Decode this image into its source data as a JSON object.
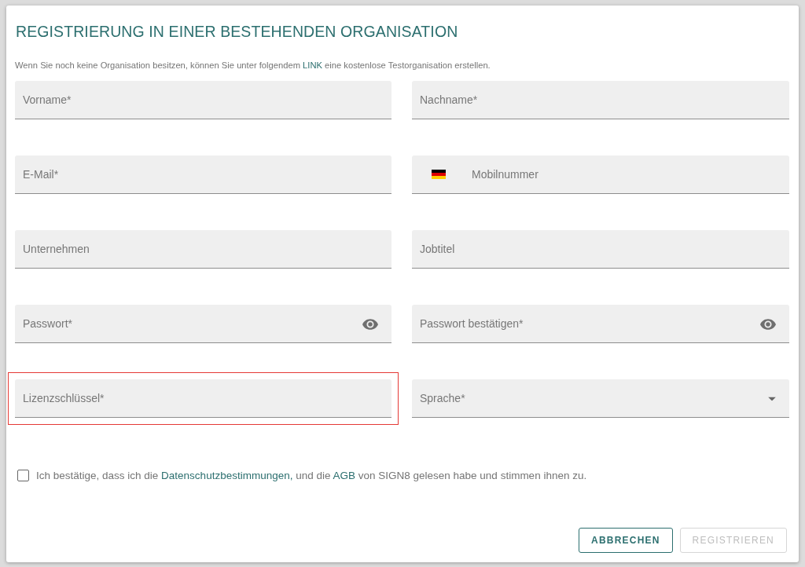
{
  "dialog": {
    "title": "REGISTRIERUNG IN EINER BESTEHENDEN ORGANISATION",
    "intro": [
      {
        "kind": "text",
        "text": "Wenn Sie noch keine Organisation besitzen, können Sie unter folgendem "
      },
      {
        "kind": "link",
        "text": "LINK"
      },
      {
        "kind": "text",
        "text": " eine kostenlose Testorganisation erstellen."
      }
    ],
    "fields": [
      {
        "kind": "text",
        "placeholder": "Vorname*",
        "highlighted": false
      },
      {
        "kind": "text",
        "placeholder": "Nachname*",
        "highlighted": false
      },
      {
        "kind": "text",
        "placeholder": "E-Mail*",
        "highlighted": false
      },
      {
        "kind": "phone",
        "placeholder": "Mobilnummer",
        "highlighted": false
      },
      {
        "kind": "text",
        "placeholder": "Unternehmen",
        "highlighted": false
      },
      {
        "kind": "text",
        "placeholder": "Jobtitel",
        "highlighted": false
      },
      {
        "kind": "password",
        "placeholder": "Passwort*",
        "highlighted": false
      },
      {
        "kind": "password",
        "placeholder": "Passwort bestätigen*",
        "highlighted": false
      },
      {
        "kind": "text",
        "placeholder": "Lizenzschlüssel*",
        "highlighted": true
      },
      {
        "kind": "select",
        "placeholder": "Sprache*",
        "highlighted": false
      }
    ],
    "consent": {
      "checked": false,
      "parts": [
        {
          "kind": "text",
          "text": "Ich bestätige, dass ich die "
        },
        {
          "kind": "link",
          "text": "Datenschutzbestimmungen,"
        },
        {
          "kind": "text",
          "text": " und die "
        },
        {
          "kind": "link",
          "text": "AGB"
        },
        {
          "kind": "text",
          "text": " von SIGN8 gelesen habe und stimmen ihnen zu."
        }
      ]
    },
    "buttons": [
      {
        "label": "ABBRECHEN",
        "disabled": false
      },
      {
        "label": "REGISTRIEREN",
        "disabled": true
      }
    ]
  }
}
